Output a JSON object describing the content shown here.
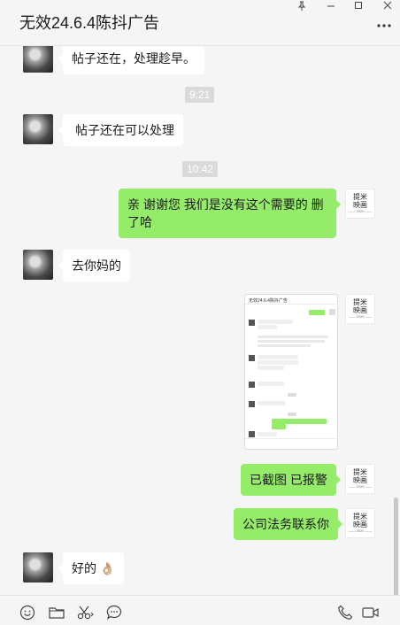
{
  "window": {
    "title": "无效24.6.4陈抖广告",
    "controls": [
      "pin-icon",
      "minimize-icon",
      "maximize-icon",
      "close-icon"
    ],
    "more_icon": "more-dots-icon"
  },
  "messages": [
    {
      "side": "left",
      "text": "帖子还在，处理趁早。"
    },
    {
      "side": "time",
      "text": "9:21"
    },
    {
      "side": "left",
      "text": "帖子还在可以处理"
    },
    {
      "side": "time",
      "text": "10:42"
    },
    {
      "side": "right",
      "text": "亲 谢谢您 我们是没有这个需要的  删了哈"
    },
    {
      "side": "left",
      "text": "去你妈的"
    },
    {
      "side": "right",
      "type": "image",
      "caption": "无效24.6.4陈抖广告"
    },
    {
      "side": "right",
      "text": "已截图 已报警"
    },
    {
      "side": "right",
      "text": "公司法务联系你"
    },
    {
      "side": "left",
      "text": "好的 👌🏼"
    }
  ],
  "self_avatar": {
    "line1": "提米",
    "line2": "映画",
    "line3": "—— 2020 ——"
  },
  "toolbar": {
    "left": [
      "emoji-icon",
      "folder-icon",
      "scissors-icon",
      "chat-history-icon"
    ],
    "right": [
      "phone-icon",
      "video-call-icon"
    ]
  },
  "colors": {
    "self_bubble": "#95ec69",
    "other_bubble": "#ffffff",
    "background": "#f5f5f5"
  }
}
